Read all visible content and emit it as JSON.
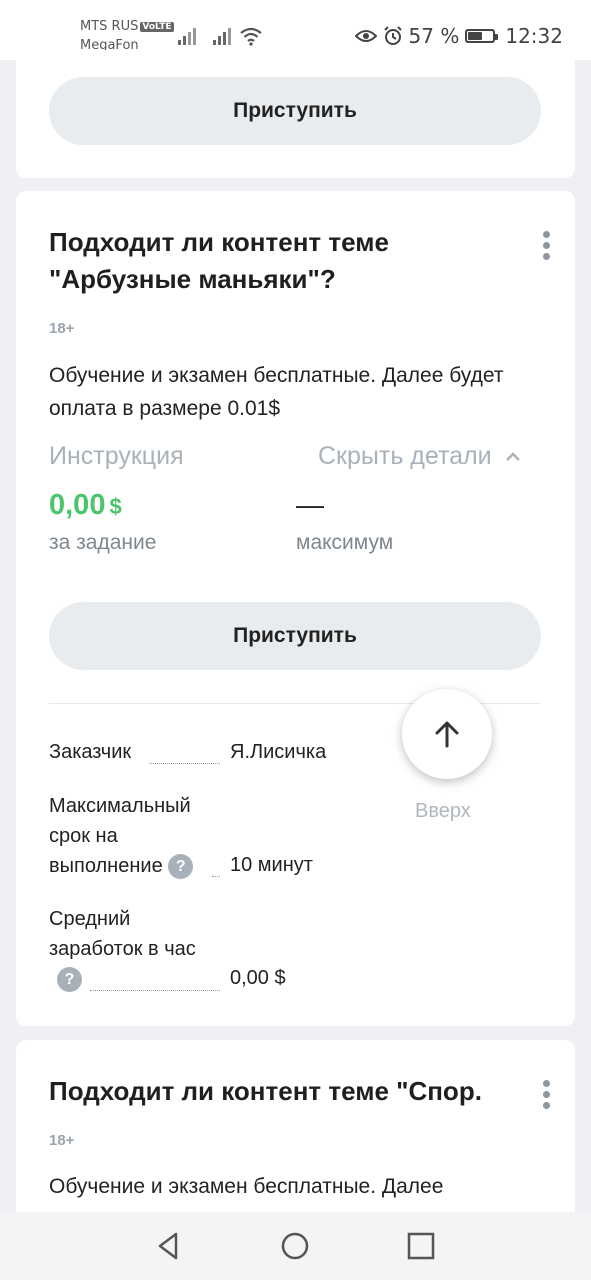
{
  "status_bar": {
    "carrier_primary": "MTS RUS",
    "volte_badge": "VoLTE",
    "carrier_secondary": "MegaFon",
    "battery_percent": "57 %",
    "battery_level": 0.57,
    "time": "12:32",
    "icons": [
      "signal-icon",
      "signal-icon",
      "wifi-icon",
      "eye-icon",
      "alarm-icon",
      "battery-icon"
    ]
  },
  "top_card": {
    "start_button": "Приступить"
  },
  "task_card": {
    "title": "Подходит ли контент теме \"Арбузные маньяки\"?",
    "age_rating": "18+",
    "description": "Обучение и экзамен бесплатные. Далее будет оплата в размере 0.01$",
    "instruction_link": "Инструкция",
    "hide_details_link": "Скрыть детали",
    "price": "0,00",
    "price_currency": "$",
    "price_caption": "за задание",
    "max_value": "—",
    "max_caption": "максимум",
    "start_button": "Приступить",
    "details": {
      "customer_label": "Заказчик",
      "customer_value": "Я.Лисичка",
      "deadline_label": "Максимальный срок на выполнение",
      "deadline_value": "10 минут",
      "earnings_label": "Средний заработок в час",
      "earnings_value": "0,00 $",
      "help_mark": "?"
    }
  },
  "scroll_top": {
    "label": "Вверх"
  },
  "next_card": {
    "title": "Подходит ли контент теме \"Спор.",
    "age_rating": "18+",
    "description": "Обучение и экзамен бесплатные. Далее"
  },
  "colors": {
    "accent_green": "#4cc46a",
    "button_bg": "#e9ecef",
    "muted_link": "#a9b1ba"
  }
}
